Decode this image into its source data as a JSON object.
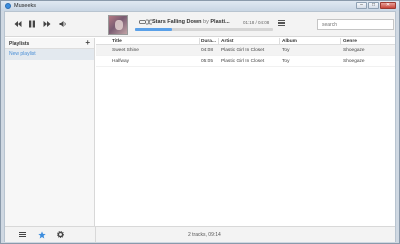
{
  "window": {
    "title": "Museeks",
    "controls": [
      "–",
      "□",
      "✕"
    ]
  },
  "player": {
    "prev_icon": "prev-icon",
    "play_pause_icon": "pause-icon",
    "next_icon": "next-icon",
    "volume_icon": "volume-icon",
    "repeat_icon": "repeat-icon",
    "shuffle_icon": "shuffle-icon",
    "track_title": "Stars Falling Down",
    "by_label": "by",
    "track_artist": "Plasti...",
    "time": "01:18 / 04:08",
    "progress_fraction": 0.27,
    "list_icon": "list-icon"
  },
  "search": {
    "placeholder": "search"
  },
  "sidebar": {
    "header": "Playlists",
    "add_label": "+",
    "items": [
      {
        "label": "New playlist"
      }
    ]
  },
  "table": {
    "columns": [
      "Title",
      "Dura...",
      "Artist",
      "Album",
      "Genre"
    ],
    "rows": [
      {
        "title": "Sweet Shine",
        "duration": "04:08",
        "artist": "Plastic Girl In Closet",
        "album": "Toy",
        "genre": "Shoegaze"
      },
      {
        "title": "Halfway",
        "duration": "05:05",
        "artist": "Plastic Girl In Closet",
        "album": "Toy",
        "genre": "Shoegaze"
      }
    ]
  },
  "footer": {
    "status": "2 tracks, 09:14",
    "buttons": [
      "library-icon",
      "star-icon",
      "gear-icon"
    ]
  },
  "colors": {
    "accent": "#3c8dde",
    "playlist_text": "#4a8fd6"
  }
}
